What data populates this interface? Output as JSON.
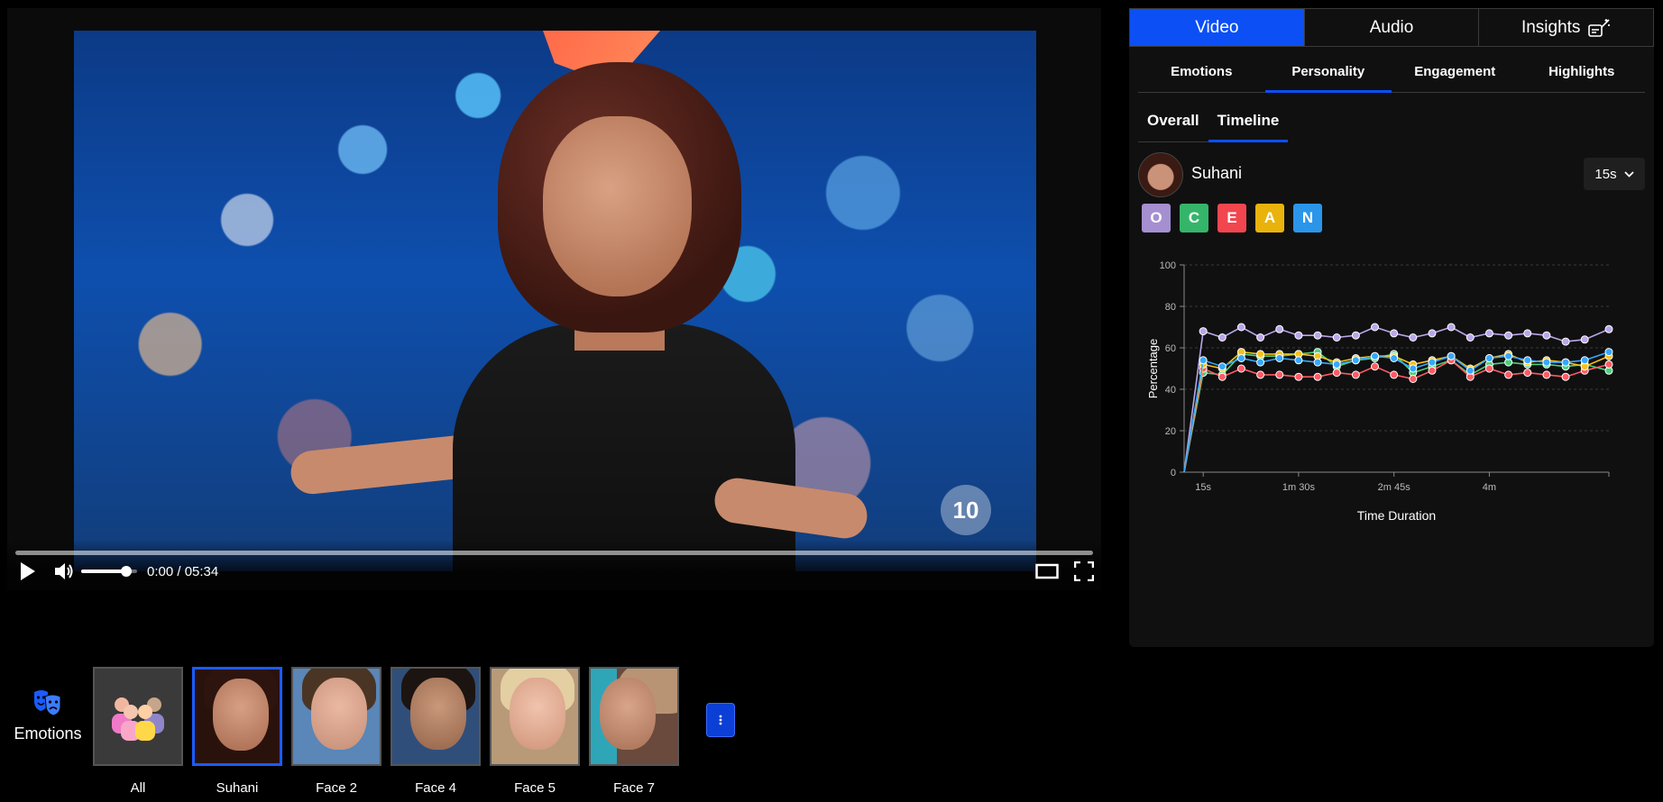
{
  "video": {
    "time_display": "0:00 / 05:34",
    "progress": 0.0,
    "volume": 0.8,
    "overlay_logo": "10"
  },
  "bottom_bar": {
    "tool_label": "Emotions",
    "faces": [
      {
        "label": "All",
        "selected": false
      },
      {
        "label": "Suhani",
        "selected": true
      },
      {
        "label": "Face 2",
        "selected": false
      },
      {
        "label": "Face 4",
        "selected": false
      },
      {
        "label": "Face 5",
        "selected": false
      },
      {
        "label": "Face 7",
        "selected": false
      }
    ]
  },
  "panel": {
    "main_tabs": [
      "Video",
      "Audio",
      "Insights"
    ],
    "active_main_tab": "Video",
    "sub_tabs": [
      "Emotions",
      "Personality",
      "Engagement",
      "Highlights"
    ],
    "active_sub_tab": "Personality",
    "view_tabs": [
      "Overall",
      "Timeline"
    ],
    "active_view_tab": "Timeline",
    "person_name": "Suhani",
    "interval": "15s",
    "traits": [
      {
        "letter": "O",
        "color": "#a58fd1"
      },
      {
        "letter": "C",
        "color": "#35b56a"
      },
      {
        "letter": "E",
        "color": "#f2464f"
      },
      {
        "letter": "A",
        "color": "#e9b30b"
      },
      {
        "letter": "N",
        "color": "#2b95ea"
      }
    ]
  },
  "colors": {
    "accent": "#0b4ff5",
    "panel_bg": "#101010"
  },
  "chart_data": {
    "type": "line",
    "title": "",
    "xlabel": "Time Duration",
    "ylabel": "Percentage",
    "ylim": [
      0,
      100
    ],
    "yticks": [
      0,
      20,
      40,
      60,
      80,
      100
    ],
    "x_tick_labels": [
      "15s",
      "1m 30s",
      "2m 45s",
      "4m"
    ],
    "x_tick_values": [
      15,
      90,
      165,
      240
    ],
    "xlim": [
      0,
      334
    ],
    "x": [
      0,
      15,
      30,
      45,
      60,
      75,
      90,
      105,
      120,
      135,
      150,
      165,
      180,
      195,
      210,
      225,
      240,
      255,
      270,
      285,
      300,
      315,
      334
    ],
    "grid": "dashed-horizontal",
    "series": [
      {
        "name": "O",
        "color": "#b9a6ea",
        "values": [
          0,
          68,
          65,
          70,
          65,
          69,
          66,
          66,
          65,
          66,
          70,
          67,
          65,
          67,
          70,
          65,
          67,
          66,
          67,
          66,
          63,
          64,
          69
        ]
      },
      {
        "name": "C",
        "color": "#4bd07c",
        "values": [
          0,
          48,
          47,
          57,
          56,
          56,
          57,
          58,
          51,
          54,
          55,
          57,
          48,
          51,
          54,
          47,
          52,
          53,
          52,
          52,
          51,
          52,
          49
        ]
      },
      {
        "name": "E",
        "color": "#ff5a63",
        "values": [
          0,
          50,
          46,
          50,
          47,
          47,
          46,
          46,
          48,
          47,
          51,
          47,
          45,
          49,
          54,
          46,
          50,
          47,
          48,
          47,
          46,
          49,
          52
        ]
      },
      {
        "name": "A",
        "color": "#f5c21a",
        "values": [
          0,
          52,
          50,
          58,
          57,
          57,
          57,
          56,
          53,
          55,
          56,
          56,
          52,
          54,
          56,
          50,
          55,
          57,
          53,
          54,
          53,
          51,
          56
        ]
      },
      {
        "name": "N",
        "color": "#36a8ff",
        "values": [
          0,
          54,
          51,
          55,
          53,
          55,
          54,
          53,
          52,
          54,
          56,
          55,
          50,
          53,
          56,
          49,
          55,
          56,
          54,
          53,
          53,
          54,
          58
        ]
      }
    ]
  }
}
